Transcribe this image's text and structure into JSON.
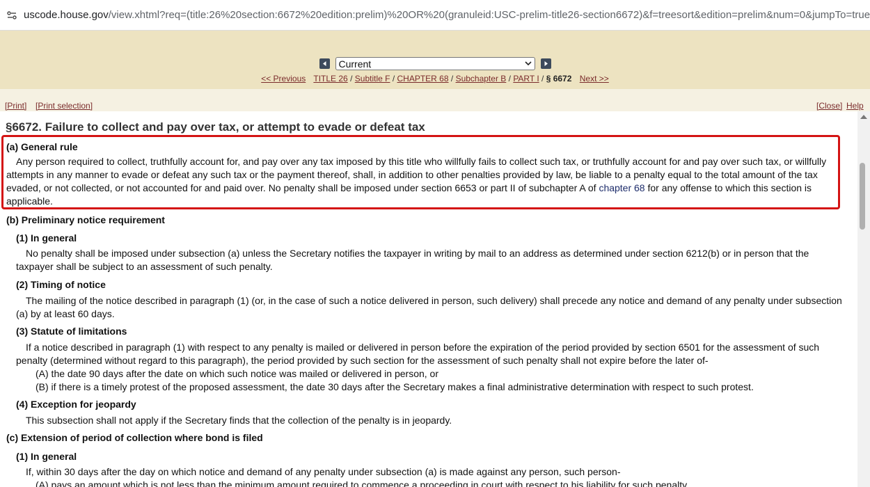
{
  "browser": {
    "url_host": "uscode.house.gov",
    "url_rest": "/view.xhtml?req=(title:26%20section:6672%20edition:prelim)%20OR%20(granuleid:USC-prelim-title26-section6672)&f=treesort&edition=prelim&num=0&jumpTo=true"
  },
  "nav": {
    "select_value": "Current",
    "previous": "<< Previous",
    "next": "Next >>",
    "crumbs": [
      "TITLE 26",
      "Subtitle F",
      "CHAPTER 68",
      "Subchapter B",
      "PART I"
    ],
    "current": "§ 6672",
    "separator": "/"
  },
  "tools": {
    "print": "[Print]",
    "print_selection": "[Print selection]",
    "close": "[Close]",
    "help": "Help"
  },
  "section": {
    "title": "§6672. Failure to collect and pay over tax, or attempt to evade or defeat tax",
    "a_head": "(a) General rule",
    "a_l1": "Any person required to collect, truthfully account for, and pay over any tax imposed by this title who willfully fails to collect such tax, or truthfully account for and pay over such tax, or willfully",
    "a_l2": "attempts in any manner to evade or defeat any such tax or the payment thereof, shall, in addition to other penalties provided by law, be liable to a penalty equal to the total amount of the tax",
    "a_l3_pre": "evaded, or not collected, or not accounted for and paid over. No penalty shall be imposed under section 6653 or part II of subchapter A of ",
    "a_l3_link": "chapter 68",
    "a_l3_post": " for any offense to which this section is",
    "a_l4": "applicable.",
    "b_head": "(b) Preliminary notice requirement",
    "b1_head": "(1) In general",
    "b1_l1": "No penalty shall be imposed under subsection (a) unless the Secretary notifies the taxpayer in writing by mail to an address as determined under section 6212(b) or in person that the",
    "b1_l2": "taxpayer shall be subject to an assessment of such penalty.",
    "b2_head": "(2) Timing of notice",
    "b2_l1": "The mailing of the notice described in paragraph (1) (or, in the case of such a notice delivered in person, such delivery) shall precede any notice and demand of any penalty under subsection",
    "b2_l2": "(a) by at least 60 days.",
    "b3_head": "(3) Statute of limitations",
    "b3_l1": "If a notice described in paragraph (1) with respect to any penalty is mailed or delivered in person before the expiration of the period provided by section 6501 for the assessment of such",
    "b3_l2": "penalty (determined without regard to this paragraph), the period provided by such section for the assessment of such penalty shall not expire before the later of-",
    "b3_A": "(A) the date 90 days after the date on which such notice was mailed or delivered in person, or",
    "b3_B": "(B) if there is a timely protest of the proposed assessment, the date 30 days after the Secretary makes a final administrative determination with respect to such protest.",
    "b4_head": "(4) Exception for jeopardy",
    "b4_l1": "This subsection shall not apply if the Secretary finds that the collection of the penalty is in jeopardy.",
    "c_head": "(c) Extension of period of collection where bond is filed",
    "c1_head": "(1) In general",
    "c1_l1": "If, within 30 days after the day on which notice and demand of any penalty under subsection (a) is made against any person, such person-",
    "c1_A": "(A) pays an amount which is not less than the minimum amount required to commence a proceeding in court with respect to his liability for such penalty,"
  },
  "colors": {
    "nav_band": "#ede3c1",
    "link": "#7a2b2b",
    "highlight": "#d41414"
  }
}
